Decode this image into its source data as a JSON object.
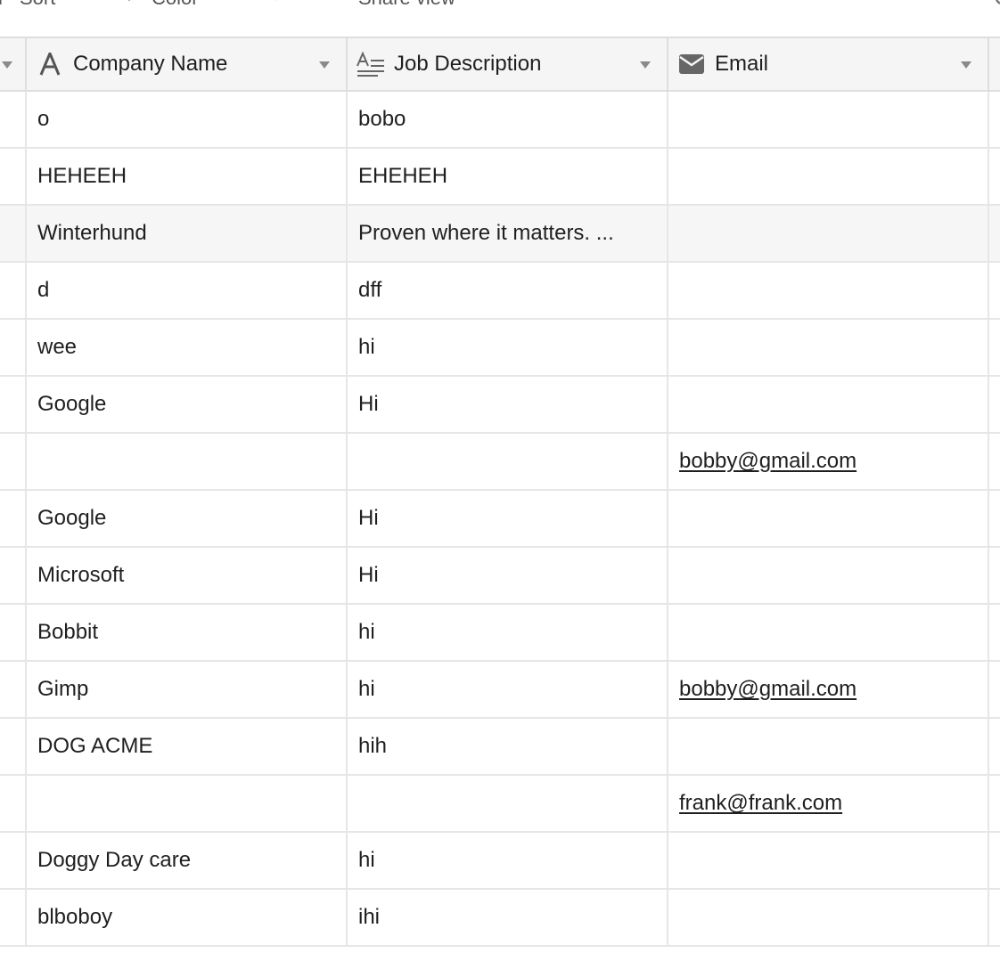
{
  "toolbar": {
    "sort_label": "Sort",
    "color_label": "Color",
    "share_label": "Share view"
  },
  "columns": {
    "company": {
      "label": "Company Name",
      "icon": "text-a-icon"
    },
    "description": {
      "label": "Job Description",
      "icon": "long-text-icon"
    },
    "email": {
      "label": "Email",
      "icon": "envelope-icon"
    }
  },
  "rows": [
    {
      "company": "o",
      "description": "bobo",
      "email": ""
    },
    {
      "company": "HEHEEH",
      "description": "EHEHEH",
      "email": ""
    },
    {
      "company": "Winterhund",
      "description": "Proven where it matters. ...",
      "email": ""
    },
    {
      "company": "d",
      "description": "dff",
      "email": ""
    },
    {
      "company": "wee",
      "description": "hi",
      "email": ""
    },
    {
      "company": "Google",
      "description": "Hi",
      "email": ""
    },
    {
      "company": "",
      "description": "",
      "email": "bobby@gmail.com"
    },
    {
      "company": "Google",
      "description": "Hi",
      "email": ""
    },
    {
      "company": "Microsoft",
      "description": "Hi",
      "email": ""
    },
    {
      "company": "Bobbit",
      "description": "hi",
      "email": ""
    },
    {
      "company": "Gimp",
      "description": "hi",
      "email": "bobby@gmail.com"
    },
    {
      "company": "DOG ACME",
      "description": "hih",
      "email": ""
    },
    {
      "company": "",
      "description": "",
      "email": "frank@frank.com"
    },
    {
      "company": "Doggy Day care",
      "description": "hi",
      "email": ""
    },
    {
      "company": "blboboy",
      "description": "ihi",
      "email": ""
    }
  ]
}
